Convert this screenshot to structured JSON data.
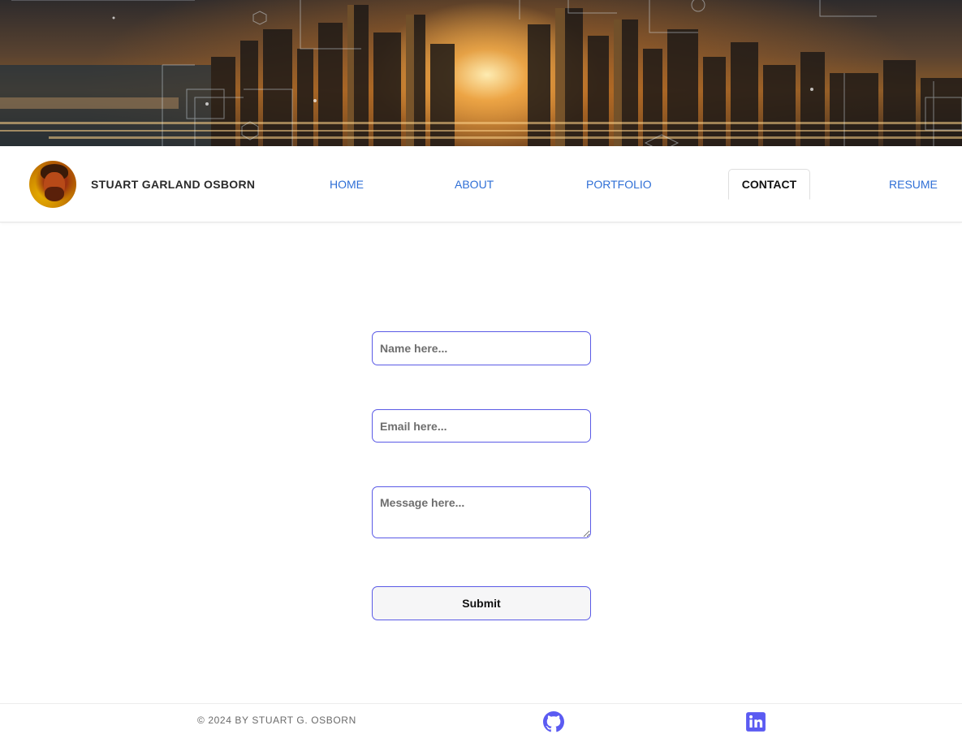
{
  "header": {
    "brand_name": "STUART GARLAND OSBORN",
    "nav": [
      {
        "label": "HOME",
        "active": false
      },
      {
        "label": "ABOUT",
        "active": false
      },
      {
        "label": "PORTFOLIO",
        "active": false
      },
      {
        "label": "CONTACT",
        "active": true
      },
      {
        "label": "RESUME",
        "active": false
      }
    ]
  },
  "contact_form": {
    "name_placeholder": "Name here...",
    "email_placeholder": "Email here...",
    "message_placeholder": "Message here...",
    "submit_label": "Submit"
  },
  "footer": {
    "copyright": "© 2024 BY STUART G. OSBORN",
    "icons": [
      "github-icon",
      "linkedin-icon"
    ]
  },
  "colors": {
    "link": "#2f6fd6",
    "input_border": "#5a5ae6",
    "social_icon": "#5b5bf2",
    "text_dark": "#2b2b2b"
  }
}
